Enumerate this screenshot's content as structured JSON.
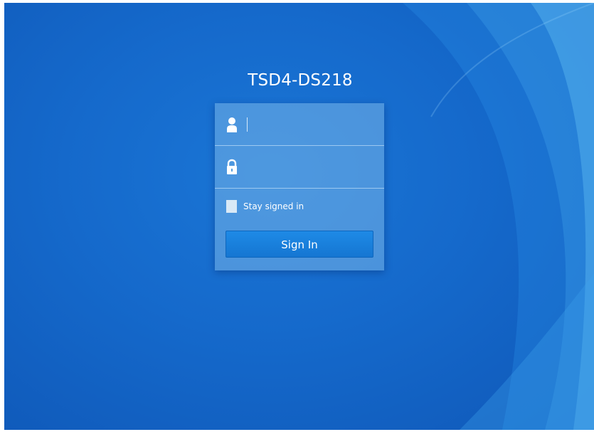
{
  "login": {
    "title": "TSD4-DS218",
    "username": {
      "value": "",
      "placeholder": "",
      "icon": "user-icon"
    },
    "password": {
      "value": "",
      "placeholder": "",
      "icon": "lock-icon"
    },
    "stay_signed_in": {
      "label": "Stay signed in",
      "checked": false
    },
    "signin_label": "Sign In"
  },
  "colors": {
    "background": "#1569cb",
    "button": "#1a80dc",
    "text": "#ffffff"
  }
}
